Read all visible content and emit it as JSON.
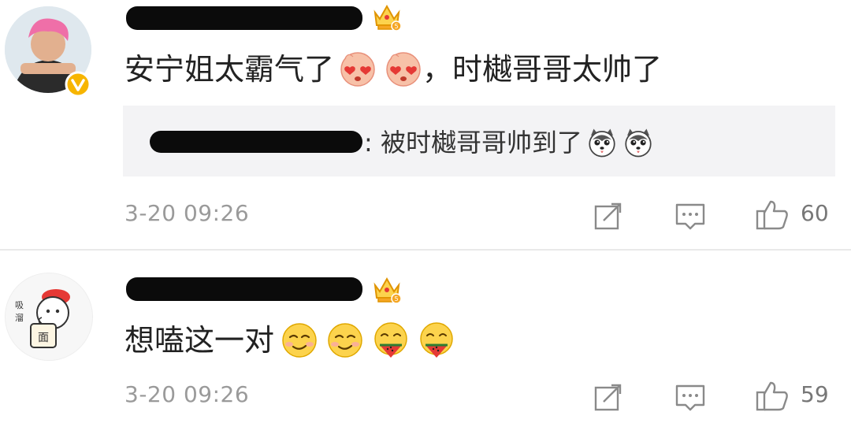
{
  "comments": [
    {
      "username_redacted": true,
      "badge": "crown-vip-icon",
      "verified": true,
      "text": "安宁姐太霸气了",
      "emojis_after_text": [
        "heart-eyes-emoji",
        "heart-eyes-emoji"
      ],
      "text_suffix": "，时樾哥哥太帅了",
      "reply": {
        "username_redacted": true,
        "text": ": 被时樾哥哥帅到了",
        "emojis": [
          "husky-emoji",
          "husky-emoji"
        ]
      },
      "timestamp": "3-20 09:26",
      "like_count": "60"
    },
    {
      "username_redacted": true,
      "badge": "crown-vip-icon",
      "verified": false,
      "text": "想嗑这一对",
      "emojis_after_text": [
        "smirk-emoji",
        "smirk-emoji",
        "eating-watermelon-emoji",
        "eating-watermelon-emoji"
      ],
      "timestamp": "3-20 09:26",
      "like_count": "59"
    }
  ],
  "colors": {
    "timestamp": "#9a9a9a",
    "reply_bg": "#f3f3f5",
    "verified_badge": "#f7b500",
    "crown": "#f5a623"
  }
}
